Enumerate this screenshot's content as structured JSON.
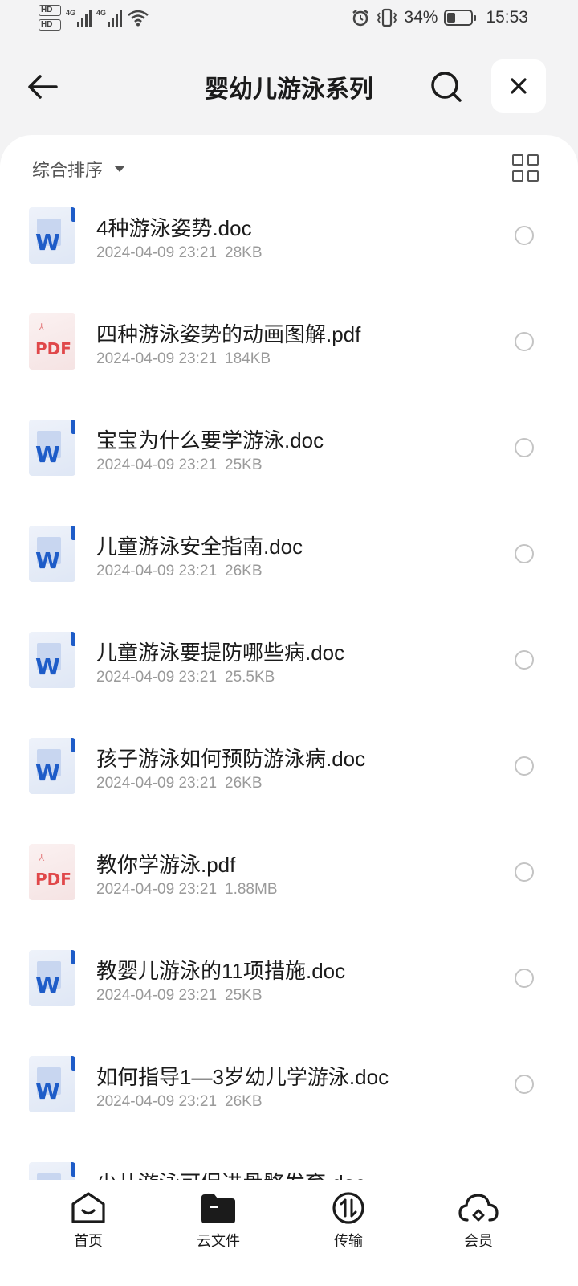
{
  "status_bar": {
    "hd1": "HD",
    "hd2": "HD",
    "net1": "4G",
    "net2": "4G",
    "battery_percent": "34%",
    "battery_level": 0.34,
    "time": "15:53"
  },
  "header": {
    "title": "婴幼儿游泳系列"
  },
  "toolbar": {
    "sort_label": "综合排序"
  },
  "files": [
    {
      "name": "4种游泳姿势.doc",
      "date": "2024-04-09 23:21",
      "size": "28KB",
      "type": "doc"
    },
    {
      "name": "四种游泳姿势的动画图解.pdf",
      "date": "2024-04-09 23:21",
      "size": "184KB",
      "type": "pdf"
    },
    {
      "name": "宝宝为什么要学游泳.doc",
      "date": "2024-04-09 23:21",
      "size": "25KB",
      "type": "doc"
    },
    {
      "name": "儿童游泳安全指南.doc",
      "date": "2024-04-09 23:21",
      "size": "26KB",
      "type": "doc"
    },
    {
      "name": "儿童游泳要提防哪些病.doc",
      "date": "2024-04-09 23:21",
      "size": "25.5KB",
      "type": "doc"
    },
    {
      "name": "孩子游泳如何预防游泳病.doc",
      "date": "2024-04-09 23:21",
      "size": "26KB",
      "type": "doc"
    },
    {
      "name": "教你学游泳.pdf",
      "date": "2024-04-09 23:21",
      "size": "1.88MB",
      "type": "pdf"
    },
    {
      "name": "教婴儿游泳的11项措施.doc",
      "date": "2024-04-09 23:21",
      "size": "25KB",
      "type": "doc"
    },
    {
      "name": "如何指导1—3岁幼儿学游泳.doc",
      "date": "2024-04-09 23:21",
      "size": "26KB",
      "type": "doc"
    },
    {
      "name": "少儿游泳可促进骨骼发育.doc",
      "date": "",
      "size": "",
      "type": "doc"
    }
  ],
  "icons": {
    "doc_glyph": "W",
    "pdf_glyph": "PDF",
    "pdf_mark": "⅄"
  },
  "nav": [
    {
      "label": "首页",
      "icon": "home-icon"
    },
    {
      "label": "云文件",
      "icon": "folder-icon"
    },
    {
      "label": "传输",
      "icon": "transfer-icon"
    },
    {
      "label": "会员",
      "icon": "cloud-icon"
    }
  ]
}
